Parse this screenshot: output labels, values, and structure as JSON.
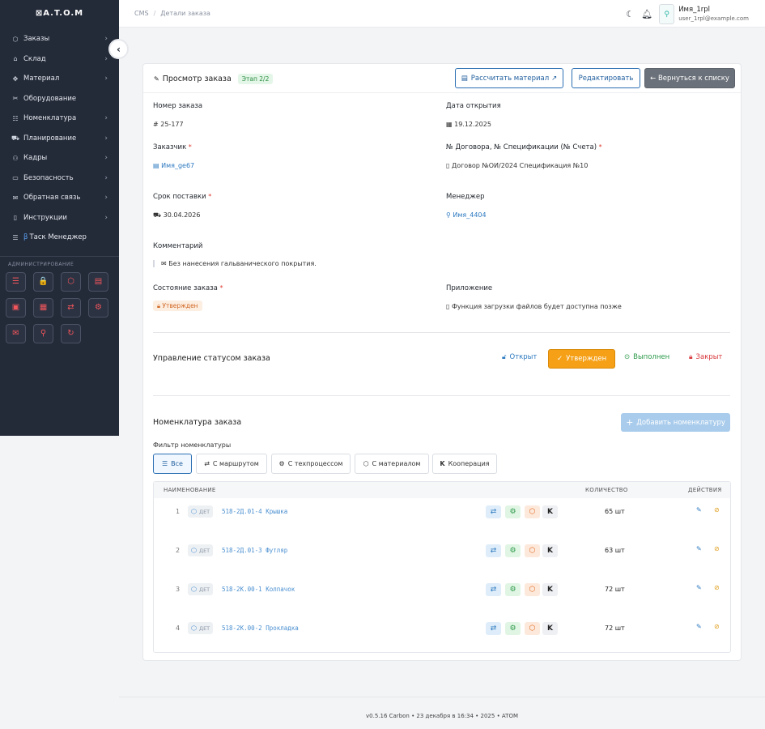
{
  "app": {
    "logo": "⊠A.T.O.M"
  },
  "sidebar": {
    "items": [
      {
        "label": "Заказы",
        "icon": "box-icon",
        "glyph": "⬡",
        "chevron": true
      },
      {
        "label": "Склад",
        "icon": "warehouse-icon",
        "glyph": "⌂",
        "chevron": true
      },
      {
        "label": "Материал",
        "icon": "material-icon",
        "glyph": "✥",
        "chevron": true
      },
      {
        "label": "Оборудование",
        "icon": "tools-icon",
        "glyph": "✂",
        "chevron": false
      },
      {
        "label": "Номенклатура",
        "icon": "list-icon",
        "glyph": "☷",
        "chevron": true
      },
      {
        "label": "Планирование",
        "icon": "truck-icon",
        "glyph": "⛟",
        "chevron": true
      },
      {
        "label": "Кадры",
        "icon": "users-icon",
        "glyph": "⚇",
        "chevron": true
      },
      {
        "label": "Безопасность",
        "icon": "monitor-icon",
        "glyph": "▭",
        "chevron": true
      },
      {
        "label": "Обратная связь",
        "icon": "message-icon",
        "glyph": "✉",
        "chevron": true
      },
      {
        "label": "Инструкции",
        "icon": "book-icon",
        "glyph": "▯",
        "chevron": true
      },
      {
        "label": "Таск Менеджер",
        "icon": "tasks-icon",
        "glyph": "☰",
        "chevron": false,
        "beta": "β"
      }
    ],
    "admin_title": "АДМИНИСТРИРОВАНИЕ",
    "admin_buttons": [
      "☰",
      "🔒",
      "⬡",
      "▤",
      "▣",
      "▦",
      "⇄",
      "⚙",
      "✉",
      "⚲",
      "↻"
    ]
  },
  "breadcrumb": {
    "root": "CMS",
    "sep": "/",
    "current": "Детали заказа"
  },
  "user": {
    "name": "Имя_1rpl",
    "email": "user_1rpl@example.com"
  },
  "order": {
    "title": "Просмотр заказа",
    "stage": "Этап 2/2",
    "btn_calc": "Рассчитать материал",
    "btn_edit": "Редактировать",
    "btn_back": "← Вернуться к списку",
    "number_label": "Номер заказа",
    "number_value": "25-177",
    "open_date_label": "Дата открытия",
    "open_date_value": "19.12.2025",
    "customer_label": "Заказчик",
    "customer_value": "Имя_ge67",
    "contract_label": "№ Договора, № Спецификации (№ Счета)",
    "contract_value": "Договор №ОИ/2024 Спецификация №10",
    "delivery_label": "Срок поставки",
    "delivery_value": "30.04.2026",
    "manager_label": "Менеджер",
    "manager_value": "Имя_4404",
    "comment_label": "Комментарий",
    "comment_value": "Без нанесения гальванического покрытия.",
    "state_label": "Состояние заказа",
    "state_value": "Утвержден",
    "attachment_label": "Приложение",
    "attachment_value": "Функция загрузки файлов будет доступна позже"
  },
  "status_mgmt": {
    "title": "Управление статусом заказа",
    "open": "Открыт",
    "approved": "Утвержден",
    "done": "Выполнен",
    "closed": "Закрыт"
  },
  "nomenclature": {
    "title": "Номенклатура заказа",
    "add_btn": "Добавить номенклатуру",
    "filter_label": "Фильтр номенклатуры",
    "filters": [
      "Все",
      "С маршрутом",
      "С техпроцессом",
      "С материалом",
      "Кооперация"
    ],
    "headers": {
      "name": "НАИМЕНОВАНИЕ",
      "qty": "КОЛИЧЕСТВО",
      "actions": "ДЕЙСТВИЯ"
    },
    "rows": [
      {
        "n": "1",
        "type": "ДЕТ",
        "code": "518-2Д.01-4",
        "name": "Крышка",
        "qty": "65 шт"
      },
      {
        "n": "2",
        "type": "ДЕТ",
        "code": "518-2Д.01-3",
        "name": "Футляр",
        "qty": "63 шт"
      },
      {
        "n": "3",
        "type": "ДЕТ",
        "code": "518-2К.00-1",
        "name": "Колпачок",
        "qty": "72 шт"
      },
      {
        "n": "4",
        "type": "ДЕТ",
        "code": "518-2К.00-2",
        "name": "Прокладка",
        "qty": "72 шт"
      }
    ]
  },
  "footer": {
    "text": "v0.5.16 Carbon • 23 декабря в 16:34 • 2025 •  ATOM"
  },
  "colors": {
    "sidebar": "#232a38",
    "accent": "#2c6fb3",
    "approved": "#f5a017"
  }
}
